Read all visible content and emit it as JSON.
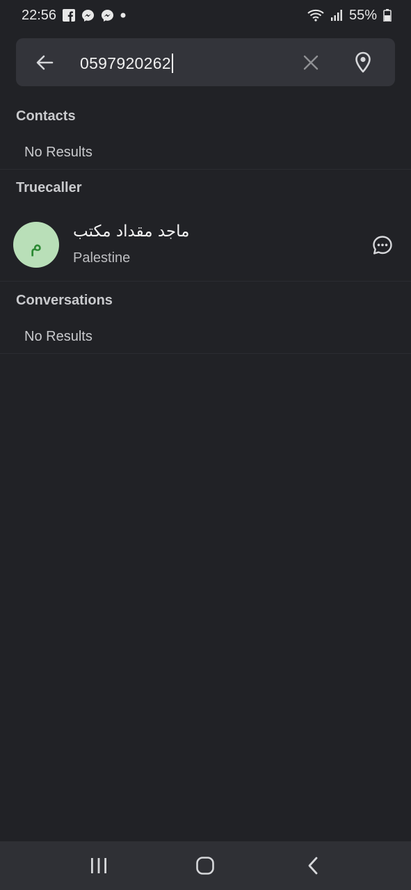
{
  "status_bar": {
    "time": "22:56",
    "battery": "55%",
    "left_icons": [
      "facebook-icon",
      "messenger-icon",
      "messenger-icon",
      "dot-icon"
    ],
    "right_icons": [
      "wifi-icon",
      "signal-icon",
      "battery-icon"
    ]
  },
  "search": {
    "query": "0597920262"
  },
  "sections": {
    "contacts": {
      "title": "Contacts",
      "empty_text": "No Results"
    },
    "truecaller": {
      "title": "Truecaller",
      "result": {
        "avatar_letter": "م",
        "name": "ماجد مقداد مكتب",
        "subtitle": "Palestine"
      }
    },
    "conversations": {
      "title": "Conversations",
      "empty_text": "No Results"
    }
  },
  "colors": {
    "background": "#212226",
    "search_bar": "#33343a",
    "avatar_bg": "#b9dfb8",
    "avatar_fg": "#2c8a34"
  }
}
